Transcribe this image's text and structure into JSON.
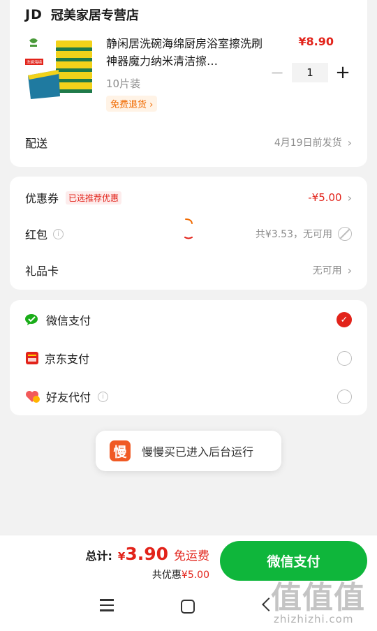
{
  "store": {
    "logo": "JD",
    "name": "冠美家居专营店"
  },
  "product": {
    "title": "静闲居洗碗海绵厨房浴室擦洗刷神器魔力纳米清洁擦…",
    "image_text": "洗碗海绵",
    "price": "¥8.90",
    "spec": "10片装",
    "free_return": "免费退货",
    "quantity": "1",
    "minus": "−",
    "plus": "+"
  },
  "delivery": {
    "label": "配送",
    "value": "4月19日前发货"
  },
  "discounts": {
    "coupon": {
      "label": "优惠券",
      "tag": "已选推荐优惠",
      "value": "-¥5.00"
    },
    "red_packet": {
      "label": "红包",
      "value": "共¥3.53，无可用"
    },
    "gift_card": {
      "label": "礼品卡",
      "value": "无可用"
    }
  },
  "payment": {
    "options": [
      {
        "label": "微信支付",
        "icon": "wechat-pay-icon",
        "selected": true
      },
      {
        "label": "京东支付",
        "icon": "jd-pay-icon",
        "selected": false
      },
      {
        "label": "好友代付",
        "icon": "friend-pay-icon",
        "selected": false
      }
    ]
  },
  "toast": {
    "icon_char": "慢",
    "text": "慢慢买已进入后台运行"
  },
  "bottom": {
    "total_label": "总计:",
    "currency": "¥",
    "total": "3.90",
    "free_shipping": "免运费",
    "saved_label": "共优惠",
    "saved_amount": "¥5.00",
    "pay_button": "微信支付"
  },
  "watermark": {
    "big": "值值值",
    "small": "zhizhizhi.com"
  },
  "colors": {
    "accent_red": "#e2231a",
    "pay_green": "#0fb63b",
    "toast_orange": "#f05a24"
  }
}
